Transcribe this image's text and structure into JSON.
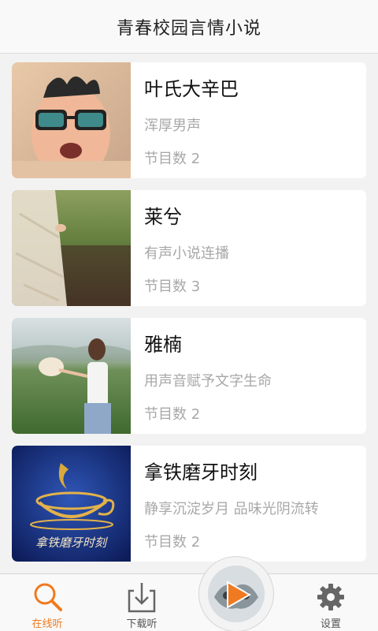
{
  "header": {
    "title": "青春校园言情小说"
  },
  "cards": [
    {
      "title": "叶氏大辛巴",
      "desc": "浑厚男声",
      "count": "节目数 2"
    },
    {
      "title": "莱兮",
      "desc": "有声小说连播",
      "count": "节目数 3"
    },
    {
      "title": "雅楠",
      "desc": "用声音赋予文字生命",
      "count": "节目数 2"
    },
    {
      "title": "拿铁磨牙时刻",
      "desc": "静享沉淀岁月 品味光阴流转",
      "count": "节目数 2",
      "cover_text": "拿铁磨牙时刻"
    }
  ],
  "tabbar": {
    "listen_online": "在线听",
    "download_listen": "下载听",
    "settings": "设置"
  },
  "colors": {
    "accent": "#f07a1f",
    "card_bg": "#ffffff",
    "page_bg": "#f2f2f2"
  },
  "icons": {
    "listen_online": "search-icon",
    "download_listen": "download-icon",
    "settings": "gear-icon",
    "player": "play-icon"
  }
}
